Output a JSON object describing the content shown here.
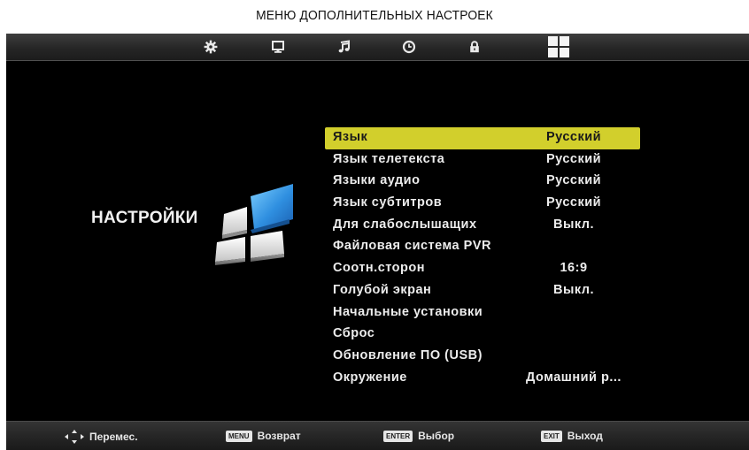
{
  "caption": "МЕНЮ ДОПОЛНИТЕЛЬНЫХ НАСТРОЕК",
  "tabs": [
    {
      "icon": "gear-icon",
      "active": false
    },
    {
      "icon": "monitor-icon",
      "active": false
    },
    {
      "icon": "music-note-icon",
      "active": false
    },
    {
      "icon": "clock-icon",
      "active": false
    },
    {
      "icon": "lock-icon",
      "active": false
    },
    {
      "icon": "settings-grid-icon",
      "active": true
    }
  ],
  "section_title": "НАСТРОЙКИ",
  "menu": {
    "selected_index": 0,
    "items": [
      {
        "label": "Язык",
        "value": "Русский"
      },
      {
        "label": "Язык телетекста",
        "value": "Русский"
      },
      {
        "label": "Языки аудио",
        "value": "Русский"
      },
      {
        "label": "Язык субтитров",
        "value": "Русский"
      },
      {
        "label": "Для слабослышащих",
        "value": "Выкл."
      },
      {
        "label": "Файловая система PVR",
        "value": ""
      },
      {
        "label": "Соотн.сторон",
        "value": "16:9"
      },
      {
        "label": "Голубой экран",
        "value": "Выкл."
      },
      {
        "label": "Начальные установки",
        "value": ""
      },
      {
        "label": "Сброс",
        "value": ""
      },
      {
        "label": "Обновление ПО (USB)",
        "value": ""
      },
      {
        "label": "Окружение",
        "value": "Домашний р..."
      }
    ]
  },
  "hints": {
    "move_icon": "dpad-arrows-icon",
    "move_label": "Перемес.",
    "back_key": "MENU",
    "back_label": "Возврат",
    "select_key": "ENTER",
    "select_label": "Выбор",
    "exit_key": "EXIT",
    "exit_label": "Выход"
  },
  "colors": {
    "highlight": "#d2cf2c",
    "background": "#000000",
    "text": "#ececec",
    "logo_blue": "#2f8fe0"
  }
}
